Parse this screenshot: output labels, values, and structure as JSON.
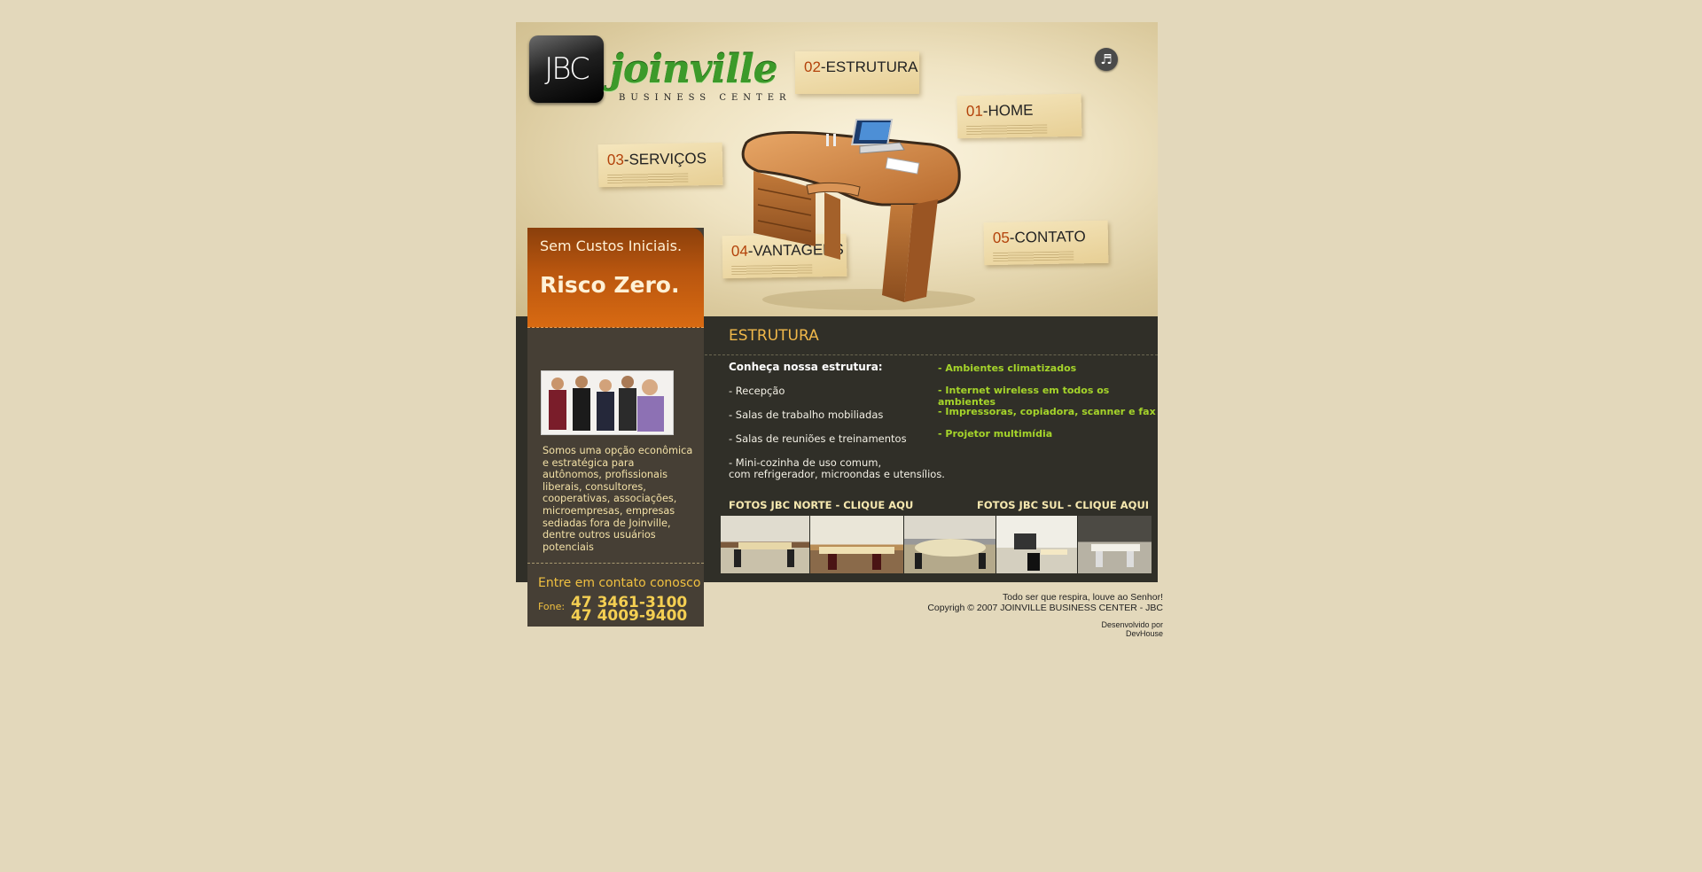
{
  "logo": {
    "badge": "JBC",
    "name": "joinville",
    "subtitle": "BUSINESS CENTER"
  },
  "nav": [
    {
      "num": "02",
      "label": "-ESTRUTURA"
    },
    {
      "num": "01",
      "label": "-HOME"
    },
    {
      "num": "03",
      "label": "-SERVIÇOS"
    },
    {
      "num": "04",
      "label": "-VANTAGENS"
    },
    {
      "num": "05",
      "label": "-CONTATO"
    }
  ],
  "music_icon": "music-note-icon",
  "promo": {
    "line1": "Sem Custos Iniciais.",
    "line2": "Risco Zero."
  },
  "left": {
    "text": "Somos uma opção econômica e estratégica para autônomos, profissionais liberais, consultores, cooperativas, associações, microempresas, empresas sediadas fora de Joinville, dentre outros usuários potenciais",
    "contact_heading": "Entre em contato conosco",
    "phone_label": "Fone:",
    "phone1": "47 3461-3100",
    "phone2": "47 4009-9400"
  },
  "section": {
    "title": "ESTRUTURA",
    "intro": "Conheça nossa estrutura:",
    "items": [
      "- Recepção",
      "- Salas de trabalho mobiliadas",
      "- Salas de reuniões e treinamentos",
      "- Mini-cozinha de uso comum,",
      "com refrigerador, microondas e utensílios."
    ],
    "amenities": [
      "- Ambientes climatizados",
      "- Internet wireless em todos os ambientes",
      "- Impressoras, copiadora, scanner e fax",
      "- Projetor multimídia"
    ],
    "fotos_norte": "FOTOS  JBC NORTE - CLIQUE AQU",
    "fotos_sul": "FOTOS  JBC SUL - CLIQUE AQUI"
  },
  "footer": {
    "line1": "Todo ser que respira, louve ao Senhor!",
    "line2": "Copyrigh © 2007 JOINVILLE BUSINESS CENTER - JBC",
    "dev1": "Desenvolvido por",
    "dev2": "DevHouse"
  }
}
